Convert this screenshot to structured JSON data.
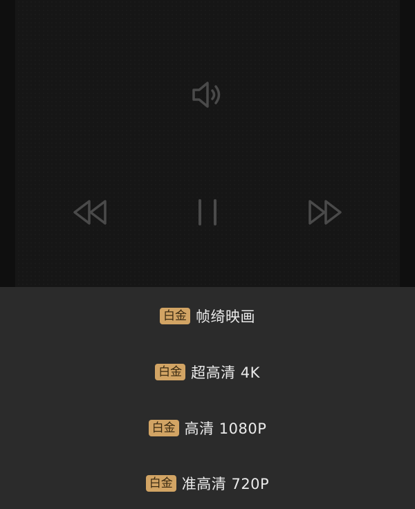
{
  "player": {
    "controls": {
      "volume_icon": "volume-icon",
      "rewind_icon": "rewind-icon",
      "pause_icon": "pause-icon",
      "forward_icon": "fast-forward-icon"
    }
  },
  "quality_menu": {
    "badge_color": "#d2a464",
    "options": [
      {
        "badge": "白金",
        "label": "帧绮映画"
      },
      {
        "badge": "白金",
        "label": "超高清 4K"
      },
      {
        "badge": "白金",
        "label": "高清 1080P"
      },
      {
        "badge": "白金",
        "label": "准高清 720P"
      }
    ]
  }
}
